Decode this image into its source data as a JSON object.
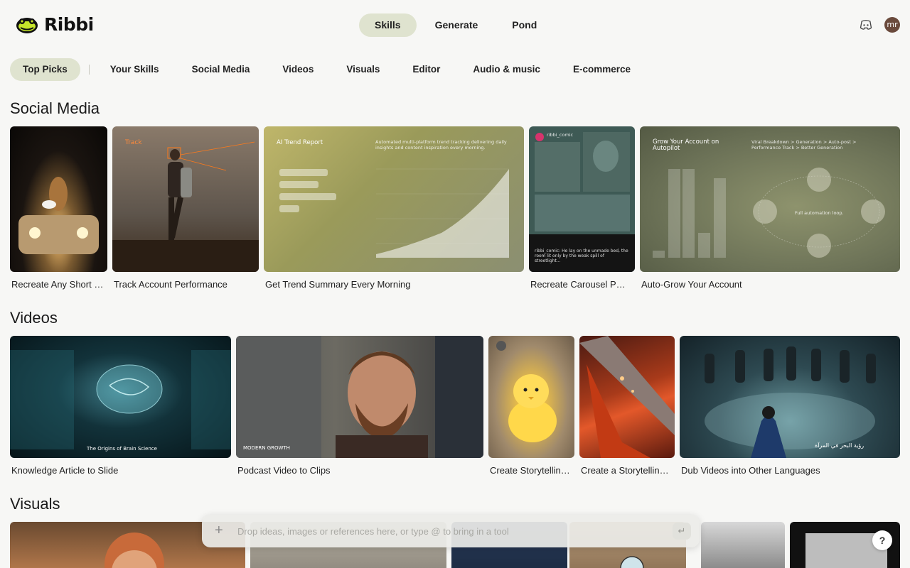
{
  "brand": {
    "name": "Ribbi"
  },
  "topnav": {
    "tabs": [
      "Skills",
      "Generate",
      "Pond"
    ],
    "active": 0
  },
  "header": {
    "avatar_initials": "mr",
    "discord_icon": "discord-icon"
  },
  "categories": [
    "Top Picks",
    "Your Skills",
    "Social Media",
    "Videos",
    "Visuals",
    "Editor",
    "Audio & music",
    "E-commerce"
  ],
  "sections": {
    "social": {
      "title": "Social Media",
      "cards": [
        "Recreate Any Short Video",
        "Track Account Performance",
        "Get Trend Summary Every Morning",
        "Recreate Carousel Posts",
        "Auto-Grow Your Account"
      ],
      "thumb_text": {
        "track": "Track",
        "trend_title": "AI Trend Report",
        "trend_desc": "Automated multi-platform trend tracking delivering daily insights and content inspiration every morning.",
        "carousel_user": "ribbi_comic",
        "carousel_caption": "ribbi_comic: He lay on the unmade bed, the room lit only by the weak spill of streetlight...",
        "grow_title": "Grow Your Account on Autopilot",
        "grow_loop": "Full automation loop.",
        "grow_steps": "Viral Breakdown > Generation > Auto-post > Performance Track > Better Generation"
      }
    },
    "videos": {
      "title": "Videos",
      "cards": [
        "Knowledge Article to Slide",
        "Podcast Video to Clips",
        "Create Storytelling Videos",
        "Create a Storytelling Video",
        "Dub Videos into Other Languages"
      ],
      "thumb_text": {
        "brain": "The Origins of Brain Science",
        "podcast": "MODERN GROWTH",
        "arabic": "رؤية البحر في المرآة"
      }
    },
    "visuals": {
      "title": "Visuals"
    }
  },
  "prompt": {
    "placeholder": "Drop ideas, images or references here, or type @ to bring in a tool",
    "plus": "+",
    "enter": "↵"
  },
  "help": {
    "label": "?"
  },
  "colors": {
    "active_pill": "#dfe3cf",
    "background": "#f7f7f5"
  }
}
